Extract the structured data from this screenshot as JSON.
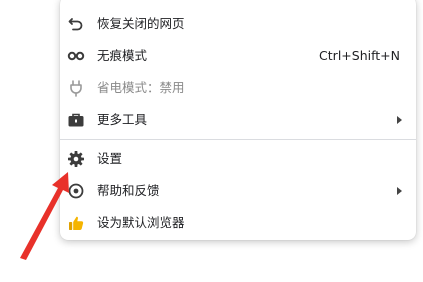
{
  "menu": {
    "items": [
      {
        "label": "恢复关闭的网页",
        "icon": "undo-arrow-icon"
      },
      {
        "label": "无痕模式",
        "shortcut": "Ctrl+Shift+N",
        "icon": "incognito-glasses-icon"
      },
      {
        "label": "省电模式：禁用",
        "icon": "power-plug-icon",
        "disabled": true
      },
      {
        "label": "更多工具",
        "icon": "toolbox-icon",
        "has_submenu": true
      },
      {
        "label": "设置",
        "icon": "gear-icon"
      },
      {
        "label": "帮助和反馈",
        "icon": "help-icon",
        "has_submenu": true
      },
      {
        "label": "设为默认浏览器",
        "icon": "thumbs-up-icon"
      }
    ]
  },
  "annotation": {
    "arrow_color": "#e8312a"
  }
}
